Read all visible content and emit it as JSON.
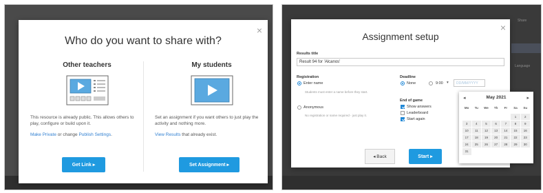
{
  "share": {
    "title": "Who do you want to share with?",
    "close": "×",
    "teachers": {
      "heading": "Other teachers",
      "description": "This resource is already public. This allows others to play, configure or build upon it.",
      "make_private": "Make Private",
      "or_change": " or change ",
      "publish_settings": "Publish Settings",
      "period": ".",
      "button": "Get Link ▸"
    },
    "students": {
      "heading": "My students",
      "description": "Set an assignment if you want others to just play the activity and nothing more.",
      "view_results": "View Results",
      "exist_text": " that already exist.",
      "button": "Set Assignment ▸"
    }
  },
  "setup": {
    "title": "Assignment setup",
    "close": "×",
    "results_title_label": "Results title",
    "results_title_value": "Result 94 for 'Alcanos'",
    "registration_label": "Registration",
    "enter_name": "Enter name",
    "enter_name_hint": "Students must enter a name before they start.",
    "anonymous": "Anonymous",
    "anonymous_hint": "No registration or name required - just play it.",
    "deadline_label": "Deadline",
    "none": "None",
    "time_value": "9:00",
    "date_placeholder": "DD/MM/YYYY",
    "end_of_game_label": "End of game",
    "show_answers": "Show answers",
    "leaderboard": "Leaderboard",
    "start_again": "Start again",
    "back_button": "◂ Back",
    "start_button": "Start ▸"
  },
  "calendar": {
    "month": "May 2021",
    "prev": "◂",
    "next": "▸",
    "dow": [
      "Mo",
      "Tu",
      "We",
      "Th",
      "Fr",
      "Sa",
      "Su"
    ],
    "days": [
      "",
      "",
      "",
      "",
      "",
      "1",
      "2",
      "3",
      "4",
      "5",
      "6",
      "7",
      "8",
      "9",
      "10",
      "11",
      "12",
      "13",
      "14",
      "15",
      "16",
      "17",
      "18",
      "19",
      "20",
      "21",
      "22",
      "23",
      "24",
      "25",
      "26",
      "27",
      "28",
      "29",
      "30",
      "31"
    ]
  },
  "background": {
    "fragments": [
      "Share",
      "Language"
    ]
  },
  "colors": {
    "accent": "#1f9ae0",
    "link": "#2f7fd1"
  }
}
